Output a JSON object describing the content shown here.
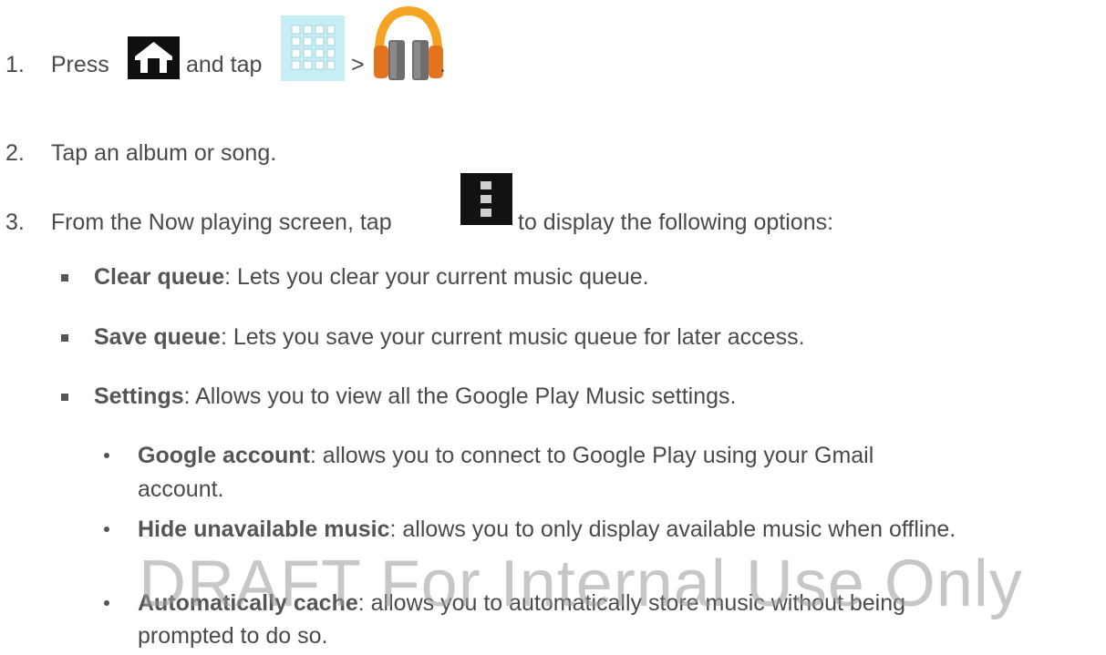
{
  "steps": [
    {
      "number": "1.",
      "segments": [
        "Press",
        "and tap",
        ">",
        "."
      ]
    },
    {
      "number": "2.",
      "text": "Tap an album or song."
    },
    {
      "number": "3.",
      "segments": [
        "From the Now playing screen, tap",
        "to display the following options:"
      ]
    }
  ],
  "options": [
    {
      "term": "Clear queue",
      "desc": ": Lets you clear your current music queue."
    },
    {
      "term": "Save queue",
      "desc": ": Lets you save your current music queue for later access."
    },
    {
      "term": "Settings",
      "desc": ": Allows you to view all the Google Play Music settings."
    }
  ],
  "settings": [
    {
      "term": "Google account",
      "desc": ": allows you to connect to Google Play using your Gmail",
      "desc2": "account."
    },
    {
      "term": "Hide unavailable music",
      "desc": ": allows you to only display available music when offline."
    },
    {
      "term": "Automatically cache",
      "desc": ": allows you to automatically store music without being",
      "desc2": "prompted to do so."
    }
  ],
  "watermark": "DRAFT For Internal Use Only",
  "icons": {
    "home": "home-icon",
    "apps": "apps-grid-icon",
    "music": "play-music-headphones-icon",
    "menu": "menu-icon"
  }
}
